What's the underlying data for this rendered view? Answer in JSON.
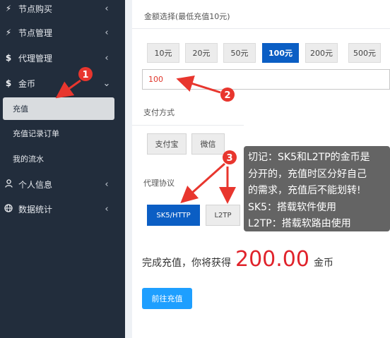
{
  "sidebar": {
    "items": [
      {
        "icon": "node-icon",
        "glyph": "⚡",
        "label": "节点购买",
        "chevron": "‹"
      },
      {
        "icon": "node-icon",
        "glyph": "⚡",
        "label": "节点管理",
        "chevron": "‹"
      },
      {
        "icon": "dollar-icon",
        "glyph": "$",
        "label": "代理管理",
        "chevron": "‹"
      },
      {
        "icon": "dollar-icon",
        "glyph": "$",
        "label": "金币",
        "chevron": "⌄"
      },
      {
        "icon": "user-icon",
        "glyph": "☺",
        "label": "个人信息",
        "chevron": "‹"
      },
      {
        "icon": "globe-icon",
        "glyph": "◍",
        "label": "数据统计",
        "chevron": "‹"
      }
    ],
    "subitems": [
      "充值",
      "充值记录订单",
      "我的流水"
    ]
  },
  "recharge": {
    "amount_label": "金额选择(最低充值10元)",
    "amounts": [
      "10元",
      "20元",
      "50元",
      "100元",
      "200元",
      "500元"
    ],
    "selected_amount": "100元",
    "amount_value": "100",
    "payment_label": "支付方式",
    "payment_methods": [
      "支付宝",
      "微信"
    ],
    "protocol_label": "代理协议",
    "protocols": [
      "SK5/HTTP",
      "L2TP"
    ],
    "selected_protocol": "SK5/HTTP",
    "result_prefix": "完成充值，你将获得",
    "result_amount": "200.00",
    "result_unit": "金币",
    "submit_label": "前往充值"
  },
  "annotations": {
    "badges": [
      "1",
      "2",
      "3"
    ],
    "note_lines": [
      "切记：SK5和L2TP的金币是",
      "分开的，充值时区分好自己",
      "的需求，充值后不能划转!",
      "SK5：搭载软件使用",
      "L2TP：搭载软路由使用"
    ],
    "marker_color": "#e8362e"
  }
}
